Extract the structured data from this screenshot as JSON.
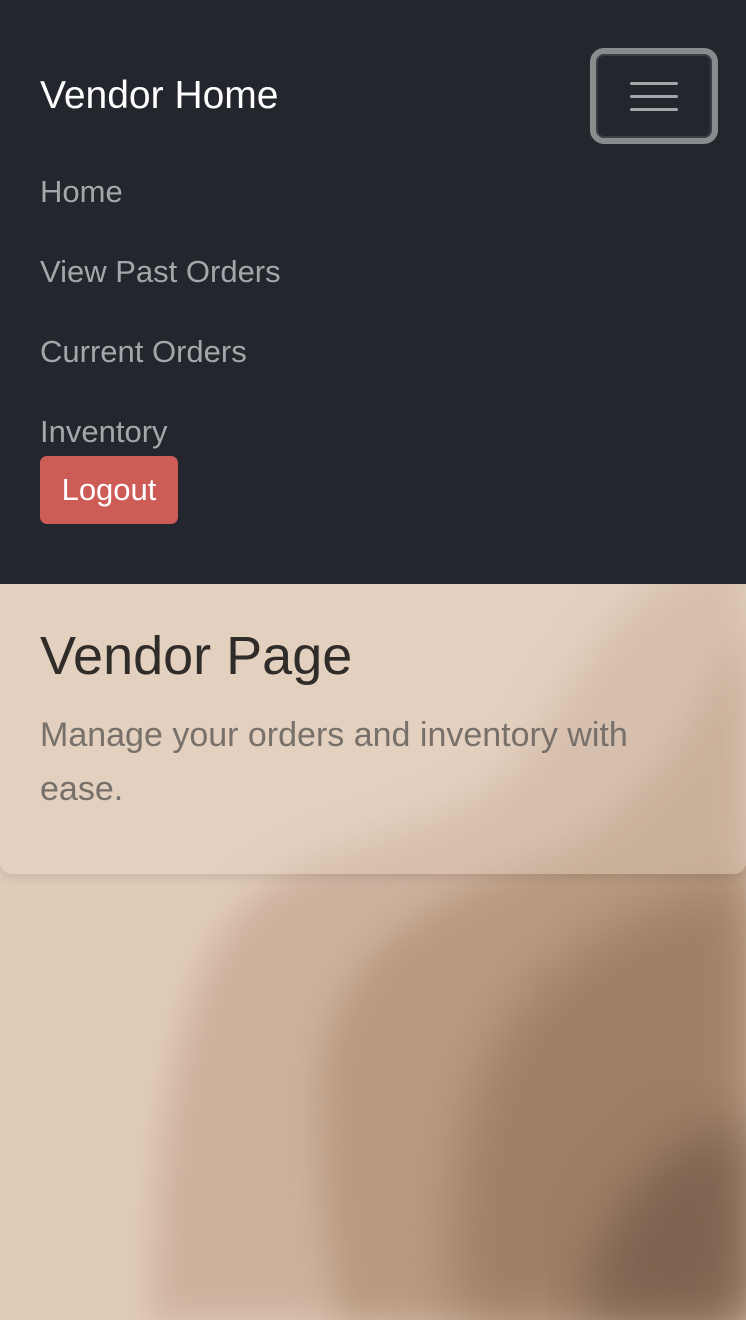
{
  "navbar": {
    "brand": "Vendor Home",
    "toggler_icon": "hamburger-menu-icon",
    "links": [
      {
        "label": "Home"
      },
      {
        "label": "View Past Orders"
      },
      {
        "label": "Current Orders"
      },
      {
        "label": "Inventory"
      }
    ],
    "logout_label": "Logout",
    "colors": {
      "background": "#23262c",
      "link": "#a4a6a9",
      "logout": "#cd5c57"
    }
  },
  "hero": {
    "title": "Vendor Page",
    "subtitle": "Manage your orders and inventory with ease."
  },
  "colors": {
    "page_background": "#e0cbb9"
  }
}
